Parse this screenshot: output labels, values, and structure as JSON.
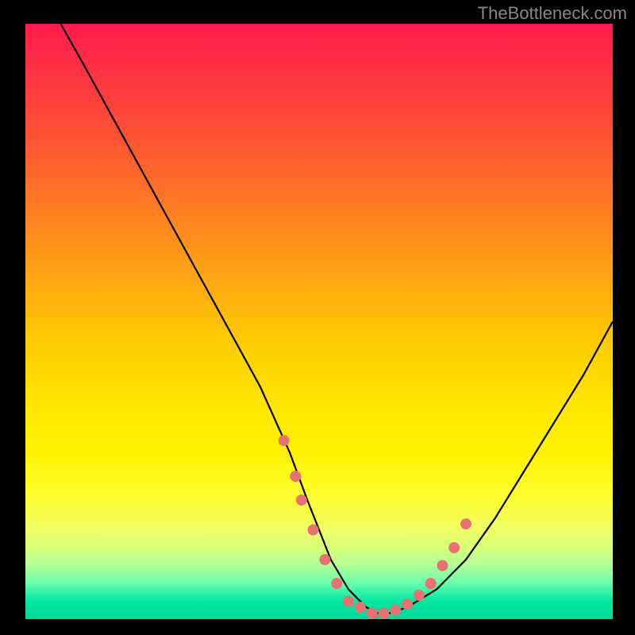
{
  "watermark": "TheBottleneck.com",
  "chart_data": {
    "type": "line",
    "title": "",
    "xlabel": "",
    "ylabel": "",
    "xlim": [
      0,
      100
    ],
    "ylim": [
      0,
      100
    ],
    "gradient_colors": {
      "top": "#ff1a4d",
      "mid_top": "#ff8022",
      "mid": "#ffe800",
      "mid_bottom": "#d8ff77",
      "bottom": "#00d898"
    },
    "curve": {
      "x": [
        6,
        10,
        15,
        20,
        25,
        30,
        35,
        40,
        45,
        48,
        50,
        52,
        55,
        58,
        60,
        62,
        65,
        70,
        75,
        80,
        85,
        90,
        95,
        100
      ],
      "y": [
        100,
        93,
        84,
        75,
        66,
        57,
        48,
        39,
        28,
        20,
        15,
        10,
        5,
        2,
        1,
        1,
        2,
        5,
        10,
        17,
        25,
        33,
        41,
        50
      ]
    },
    "dots": {
      "color": "#e87272",
      "radius": 7,
      "points": [
        {
          "x": 44,
          "y": 30
        },
        {
          "x": 46,
          "y": 24
        },
        {
          "x": 47,
          "y": 20
        },
        {
          "x": 49,
          "y": 15
        },
        {
          "x": 51,
          "y": 10
        },
        {
          "x": 53,
          "y": 6
        },
        {
          "x": 55,
          "y": 3
        },
        {
          "x": 57,
          "y": 2
        },
        {
          "x": 59,
          "y": 1
        },
        {
          "x": 61,
          "y": 1
        },
        {
          "x": 63,
          "y": 1.5
        },
        {
          "x": 65,
          "y": 2.5
        },
        {
          "x": 67,
          "y": 4
        },
        {
          "x": 69,
          "y": 6
        },
        {
          "x": 71,
          "y": 9
        },
        {
          "x": 73,
          "y": 12
        },
        {
          "x": 75,
          "y": 16
        }
      ]
    }
  }
}
